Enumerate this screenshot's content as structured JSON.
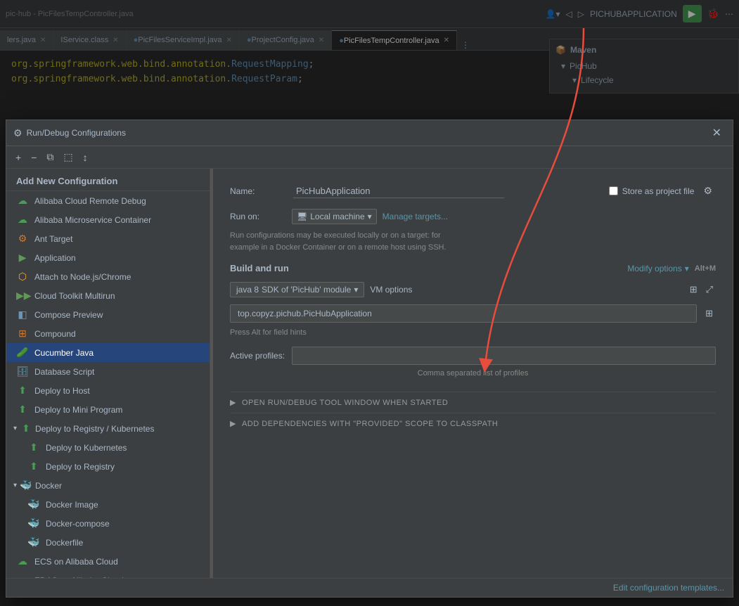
{
  "ide": {
    "titlebar": {
      "app_name": "PICHUBAPPLICATION",
      "run_config": "PICHUBAPPLICATION"
    },
    "tabs": [
      {
        "label": "lers.java",
        "active": false,
        "closable": true
      },
      {
        "label": "IService.class",
        "active": false,
        "closable": true
      },
      {
        "label": "PicFilesServiceImpl.java",
        "active": false,
        "closable": true
      },
      {
        "label": "ProjectConfig.java",
        "active": false,
        "closable": true
      },
      {
        "label": "PicFilesTempController.java",
        "active": true,
        "closable": true
      }
    ],
    "code_lines": [
      "org.springframework.web.bind.annotation.RequestMapping;",
      "org.springframework.web.bind.annotation.RequestParam;"
    ]
  },
  "maven_panel": {
    "visible": true,
    "header": "Maven",
    "items": [
      {
        "label": "PicHub",
        "indent": 1
      },
      {
        "label": "Lifecycle",
        "indent": 2
      }
    ]
  },
  "dialog": {
    "title": "Run/Debug Configurations",
    "toolbar_buttons": [
      "+",
      "−",
      "⧉",
      "⬚",
      "↕"
    ],
    "sidebar_header": "Add New Configuration",
    "sidebar_items": [
      {
        "id": "alibaba-remote",
        "label": "Alibaba Cloud Remote Debug",
        "icon": "☁",
        "icon_class": "icon-cloud",
        "indent": 0,
        "group": false
      },
      {
        "id": "alibaba-microservice",
        "label": "Alibaba Microservice Container",
        "icon": "☁",
        "icon_class": "icon-cloud",
        "indent": 0,
        "group": false
      },
      {
        "id": "ant-target",
        "label": "Ant Target",
        "icon": "🐜",
        "icon_class": "",
        "indent": 0,
        "group": false
      },
      {
        "id": "application",
        "label": "Application",
        "icon": "▶",
        "icon_class": "icon-green",
        "indent": 0,
        "group": false
      },
      {
        "id": "attach-node",
        "label": "Attach to Node.js/Chrome",
        "icon": "⬡",
        "icon_class": "icon-green",
        "indent": 0,
        "group": false
      },
      {
        "id": "cloud-toolkit",
        "label": "Cloud Toolkit Multirun",
        "icon": "▶▶",
        "icon_class": "icon-green",
        "indent": 0,
        "group": false
      },
      {
        "id": "compose-preview",
        "label": "Compose Preview",
        "icon": "◧",
        "icon_class": "icon-blue",
        "indent": 0,
        "group": false
      },
      {
        "id": "compound",
        "label": "Compound",
        "icon": "⊞",
        "icon_class": "icon-orange",
        "indent": 0,
        "group": false
      },
      {
        "id": "cucumber-java",
        "label": "Cucumber Java",
        "icon": "🥒",
        "icon_class": "icon-green",
        "indent": 0,
        "group": false,
        "active": true
      },
      {
        "id": "database-script",
        "label": "Database Script",
        "icon": "🗄",
        "icon_class": "icon-blue",
        "indent": 0,
        "group": false
      },
      {
        "id": "deploy-to-host",
        "label": "Deploy to Host",
        "icon": "⬆",
        "icon_class": "icon-cloud",
        "indent": 0,
        "group": false
      },
      {
        "id": "deploy-to-mini",
        "label": "Deploy to Mini Program",
        "icon": "⬆",
        "icon_class": "icon-cloud",
        "indent": 0,
        "group": false
      },
      {
        "id": "deploy-to-registry",
        "label": "Deploy to Registry / Kubernetes",
        "icon": "⬆",
        "icon_class": "icon-cloud",
        "indent": 0,
        "group": true,
        "expanded": true
      },
      {
        "id": "deploy-kubernetes",
        "label": "Deploy to Kubernetes",
        "icon": "⬆",
        "icon_class": "icon-cloud",
        "indent": 1,
        "group": false
      },
      {
        "id": "deploy-registry",
        "label": "Deploy to Registry",
        "icon": "⬆",
        "icon_class": "icon-cloud",
        "indent": 1,
        "group": false
      },
      {
        "id": "docker",
        "label": "Docker",
        "icon": "🐳",
        "icon_class": "icon-blue",
        "indent": 0,
        "group": true,
        "expanded": true
      },
      {
        "id": "docker-image",
        "label": "Docker Image",
        "icon": "🐳",
        "icon_class": "icon-blue",
        "indent": 1,
        "group": false
      },
      {
        "id": "docker-compose",
        "label": "Docker-compose",
        "icon": "🐳",
        "icon_class": "icon-blue",
        "indent": 1,
        "group": false
      },
      {
        "id": "dockerfile",
        "label": "Dockerfile",
        "icon": "🐳",
        "icon_class": "icon-blue",
        "indent": 1,
        "group": false
      },
      {
        "id": "ecs-alibaba",
        "label": "ECS on Alibaba Cloud",
        "icon": "☁",
        "icon_class": "icon-cloud",
        "indent": 0,
        "group": false
      },
      {
        "id": "edas-alibaba",
        "label": "EDAS on Alibaba Cloud",
        "icon": "☁",
        "icon_class": "icon-cloud",
        "indent": 0,
        "group": false
      }
    ],
    "content": {
      "name_label": "Name:",
      "name_value": "PicHubApplication",
      "store_as_project": "Store as project file",
      "run_on_label": "Run on:",
      "run_on_value": "Local machine",
      "run_on_icon": "🖥",
      "manage_targets": "Manage targets...",
      "run_on_description": "Run configurations may be executed locally or on a target: for\nexample in a Docker Container or on a remote host using SSH.",
      "build_run_label": "Build and run",
      "modify_options": "Modify options",
      "modify_shortcut": "Alt+M",
      "sdk_label": "java 8",
      "sdk_suffix": "SDK of 'PicHub' module",
      "vm_options_label": "VM options",
      "main_class_value": "top.copyz.pichub.PicHubApplication",
      "field_hint": "Press Alt for field hints",
      "active_profiles_label": "Active profiles:",
      "active_profiles_placeholder": "",
      "profiles_hint": "Comma separated list of profiles",
      "open_run_debug": "OPEN RUN/DEBUG TOOL WINDOW WHEN STARTED",
      "add_dependencies": "ADD DEPENDENCIES WITH \"PROVIDED\" SCOPE TO CLASSPATH"
    },
    "footer": {
      "edit_link": "Edit configuration templates..."
    }
  }
}
